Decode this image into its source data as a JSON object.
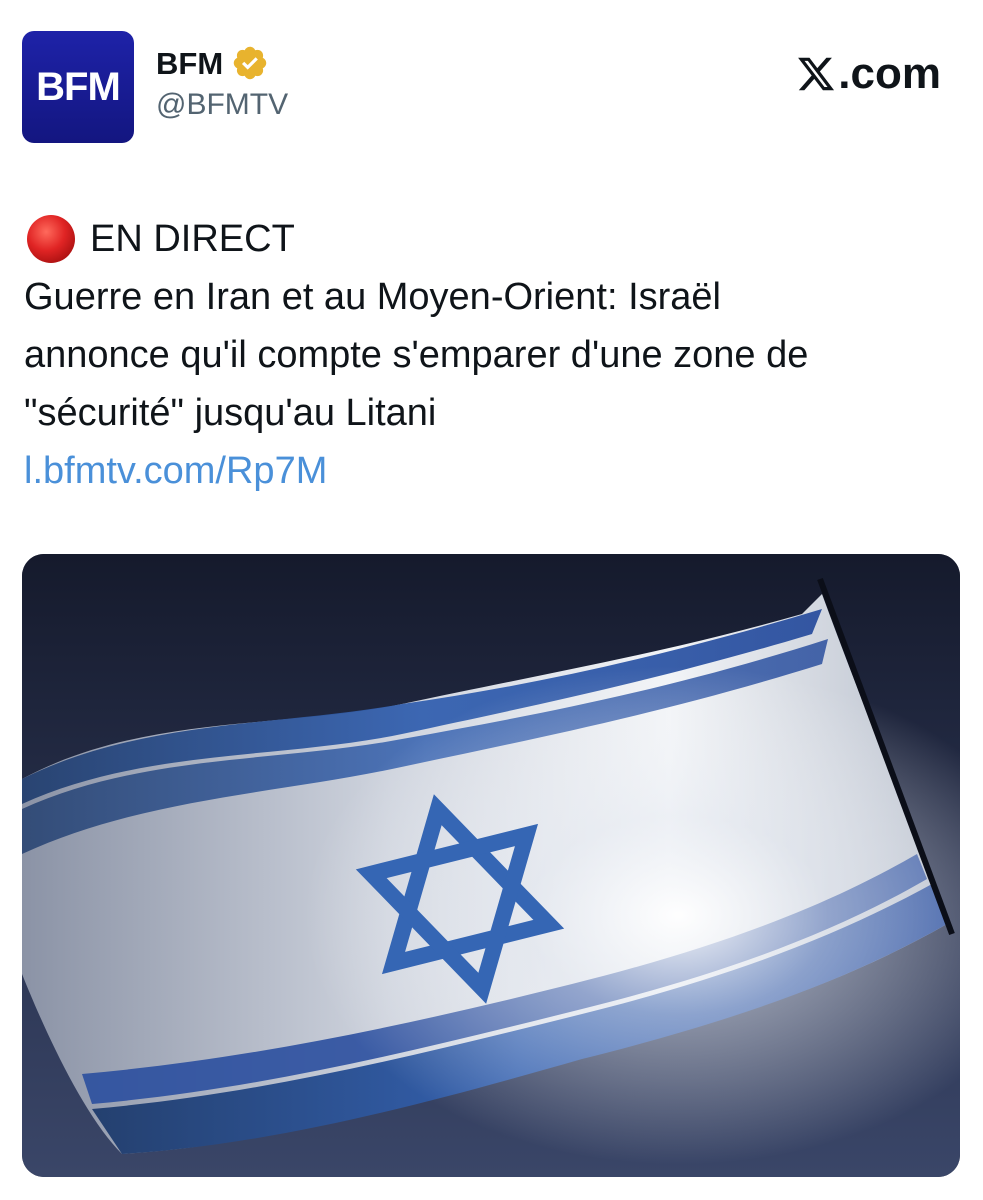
{
  "author": {
    "avatar_text": "BFM",
    "display_name": "BFM",
    "handle": "@BFMTV",
    "verified": true
  },
  "brand": {
    "label": ".com"
  },
  "tweet": {
    "live_label": "EN DIRECT",
    "text_lines": [
      "Guerre en Iran et au Moyen-Orient: Israël",
      "annonce qu'il compte s'emparer d'une zone de",
      "\"sécurité\" jusqu'au Litani"
    ],
    "link": "l.bfmtv.com/Rp7M"
  },
  "colors": {
    "avatar_bg": "#1a1e9a",
    "verified_badge": "#e8b32e",
    "live_dot": "#e02424",
    "link": "#4a90d9",
    "flag_blue": "#2b4f9e"
  },
  "media": {
    "icon": "israeli-flag-photo"
  }
}
